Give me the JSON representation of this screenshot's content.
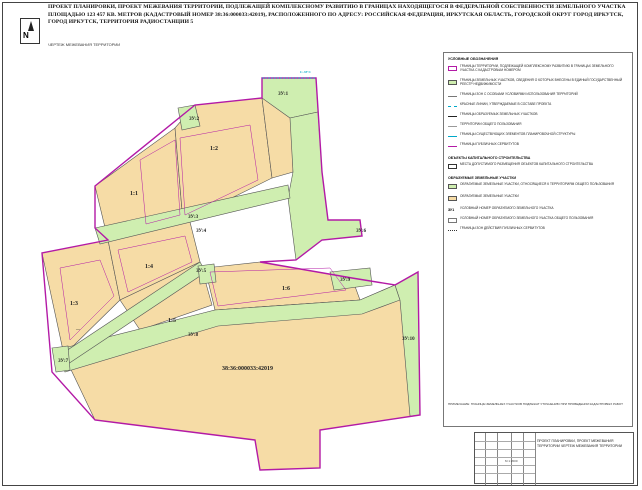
{
  "title": "ПРОЕКТ ПЛАНИРОВКИ, ПРОЕКТ МЕЖЕВАНИЯ ТЕРРИТОРИИ, ПОДЛЕЖАЩЕЙ КОМПЛЕКСНОМУ РАЗВИТИЮ В ГРАНИЦАХ НАХОДЯЩЕГОСЯ В ФЕДЕРАЛЬНОЙ СОБСТВЕННОСТИ ЗЕМЕЛЬНОГО УЧАСТКА ПЛОЩАДЬЮ 123 457 КВ. МЕТРОВ (КАДАСТРОВЫЙ НОМЕР 38:36:000033:42019), РАСПОЛОЖЕННОГО ПО АДРЕСУ: РОССИЙСКАЯ ФЕДЕРАЦИЯ, ИРКУТСКАЯ ОБЛАСТЬ, ГОРОДСКОЙ ОКРУГ ГОРОД ИРКУТСК, ГОРОД ИРКУТСК, ТЕРРИТОРИЯ РАДИОСТАНЦИИ 5",
  "subtitle": "ЧЕРТЕЖ МЕЖЕВАНИЯ ТЕРРИТОРИИ",
  "north_label": "N",
  "map": {
    "colors": {
      "parcel_fill": "#f6dca6",
      "green_fill": "#cfeeb0",
      "magenta": "#b31aa6",
      "line": "#555555",
      "cyan": "#00a8c8"
    },
    "labels": {
      "zu1": "ЗУ:1",
      "zu2": "ЗУ:2",
      "zu3": "ЗУ:3",
      "zu4": "ЗУ:4",
      "zu5": "ЗУ:5",
      "zu6": "ЗУ:6",
      "zu7": "ЗУ:7",
      "zu8": "ЗУ:8",
      "zu9": "ЗУ:9",
      "zu10": "ЗУ:10",
      "p11": "1:1",
      "p12": "1:2",
      "p13": "1:3",
      "p14": "1:4",
      "p15": "1:5",
      "p16": "1:6",
      "zu_small": "ЗУ:5",
      "cadastral": "38:36:000033:42019",
      "cyan_tag": "С-ЗУ:1",
      "dash": "—"
    }
  },
  "legend": {
    "heading1": "УСЛОВНЫЕ ОБОЗНАЧЕНИЯ",
    "heading2": "ОБЪЕКТЫ КАПИТАЛЬНОГО СТРОИТЕЛЬСТВА",
    "heading3": "ОБРАЗУЕМЫЕ ЗЕМЕЛЬНЫЕ УЧАСТКИ",
    "items": [
      {
        "text": "ГРАНИЦЫ ТЕРРИТОРИИ, ПОДЛЕЖАЩЕЙ КОМПЛЕКСНОМУ РАЗВИТИЮ В ГРАНИЦАХ ЗЕМЕЛЬНОГО УЧАСТКА С КАДАСТРОВЫМ НОМЕРОМ",
        "type": "magenta-box"
      },
      {
        "text": "ГРАНИЦЫ ЗЕМЕЛЬНЫХ УЧАСТКОВ, СВЕДЕНИЯ О КОТОРЫХ ВНЕСЕНЫ В ЕДИНЫЙ ГОСУДАРСТВЕННЫЙ РЕЕСТР НЕДВИЖИМОСТИ",
        "type": "green-box"
      },
      {
        "text": "ГРАНИЦЫ ЗОН С ОСОБЫМИ УСЛОВИЯМИ ИСПОЛЬЗОВАНИЯ ТЕРРИТОРИЙ",
        "type": "line-gray"
      },
      {
        "text": "КРАСНЫЕ ЛИНИИ, УТВЕРЖДАЕМЫЕ В СОСТАВЕ ПРОЕКТА",
        "type": "line-cyan"
      },
      {
        "text": "ГРАНИЦЫ ОБРАЗУЕМЫХ ЗЕМЕЛЬНЫХ УЧАСТКОВ",
        "type": "line-dark"
      },
      {
        "text": "ТЕРРИТОРИИ ОБЩЕГО ПОЛЬЗОВАНИЯ",
        "type": "line-gray"
      },
      {
        "text": "ГРАНИЦЫ СУЩЕСТВУЮЩИХ ЭЛЕМЕНТОВ ПЛАНИРОВОЧНОЙ СТРУКТУРЫ",
        "type": "line-cyan"
      },
      {
        "text": "ГРАНИЦЫ ПУБЛИЧНЫХ СЕРВИТУТОВ",
        "type": "line-magenta"
      },
      {
        "text": "МЕСТА ДОПУСТИМОГО РАЗМЕЩЕНИЯ ОБЪЕКТОВ КАПИТАЛЬНОГО СТРОИТЕЛЬСТВА",
        "type": "line-dark"
      },
      {
        "text": "ОБРАЗУЕМЫЕ ЗЕМЕЛЬНЫЕ УЧАСТКИ, ОТНОСЯЩИЕСЯ К ТЕРРИТОРИЯМ ОБЩЕГО ПОЛЬЗОВАНИЯ",
        "type": "green-box"
      },
      {
        "text": "ОБРАЗУЕМЫЕ ЗЕМЕЛЬНЫЕ УЧАСТКИ",
        "type": "beige-box"
      },
      {
        "text": "УСЛОВНЫЙ НОМЕР ОБРАЗУЕМОГО ЗЕМЕЛЬНОГО УЧАСТКА",
        "type": "tag"
      },
      {
        "text": "УСЛОВНЫЙ НОМЕР ОБРАЗУЕМОГО ЗЕМЕЛЬНОГО УЧАСТКА ОБЩЕГО ПОЛЬЗОВАНИЯ",
        "type": "tag"
      },
      {
        "text": "ГРАНИЦЫ ЗОН ДЕЙСТВИЯ ПУБЛИЧНЫХ СЕРВИТУТОВ",
        "type": "line-dark"
      }
    ],
    "tag_label": "ЗУ1",
    "note": "ПРИМЕЧАНИЕ: ГРАНИЦЫ ЗЕМЕЛЬНЫХ УЧАСТКОВ ПОДЛЕЖАТ УТОЧНЕНИЮ ПРИ ПРОВЕДЕНИИ КАДАСТРОВЫХ РАБОТ"
  },
  "stamp": {
    "text": "ПРОЕКТ ПЛАНИРОВКИ, ПРОЕКТ МЕЖЕВАНИЯ ТЕРРИТОРИИ ЧЕРТЕЖ МЕЖЕВАНИЯ ТЕРРИТОРИИ",
    "scale": "М 1:2000"
  }
}
